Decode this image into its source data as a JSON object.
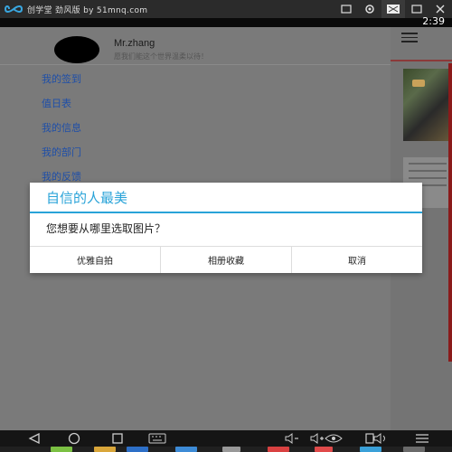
{
  "window": {
    "title": "创学堂 劲风版 by 51mnq.com"
  },
  "status_bar": {
    "time": "2:39"
  },
  "drawer": {
    "user_name": "Mr.zhang",
    "motto": "愿我们能这个世界温柔以待！",
    "menu_items": [
      {
        "label": "我的签到"
      },
      {
        "label": "值日表"
      },
      {
        "label": "我的信息"
      },
      {
        "label": "我的部门"
      },
      {
        "label": "我的反馈"
      }
    ]
  },
  "dialog": {
    "title": "自信的人最美",
    "message": "您想要从哪里选取图片？",
    "buttons": [
      {
        "label": "优雅自拍"
      },
      {
        "label": "相册收藏"
      },
      {
        "label": "取消"
      }
    ]
  },
  "colors": {
    "dialog_accent": "#29a3d8",
    "menu_text": "#1f4fa8",
    "scrim": "#6b6b6b"
  },
  "icons": {
    "title_logo": "infinity-logo",
    "nav": [
      "back-icon",
      "home-icon",
      "recent-apps-icon",
      "keyboard-icon",
      "volume-down-icon",
      "volume-up-icon",
      "screen-icon",
      "eye-icon",
      "rotate-icon",
      "menu-icon"
    ]
  }
}
